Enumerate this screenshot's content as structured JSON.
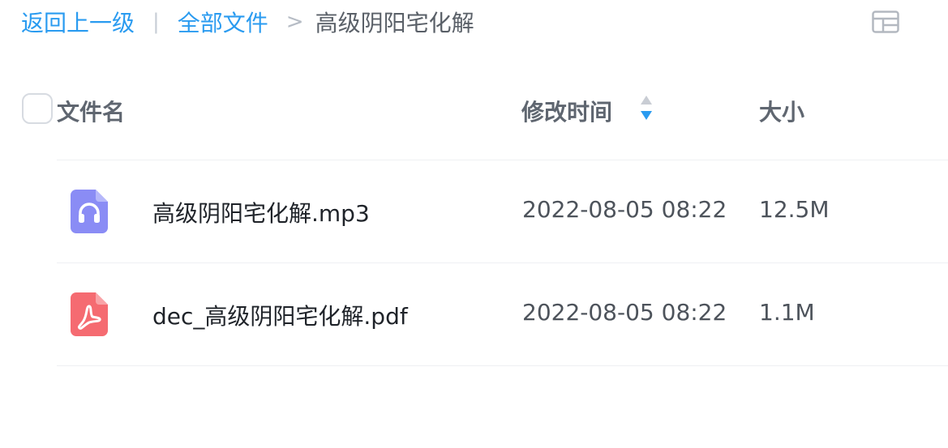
{
  "breadcrumb": {
    "back_label": "返回上一级",
    "separator": "|",
    "root_label": "全部文件",
    "arrow": ">",
    "current": "高级阴阳宅化解"
  },
  "table": {
    "columns": {
      "name": "文件名",
      "modified": "修改时间",
      "size": "大小"
    },
    "rows": [
      {
        "name": "高级阴阳宅化解.mp3",
        "modified": "2022-08-05 08:22",
        "size": "12.5M",
        "icon": "audio-file-icon",
        "icon_color": "#8a8cf5"
      },
      {
        "name": "dec_高级阴阳宅化解.pdf",
        "modified": "2022-08-05 08:22",
        "size": "1.1M",
        "icon": "pdf-file-icon",
        "icon_color": "#f56b71"
      }
    ]
  },
  "colors": {
    "link": "#2a9bf0",
    "sort_active": "#2a9bf0",
    "sort_inactive": "#c9cdd4"
  }
}
